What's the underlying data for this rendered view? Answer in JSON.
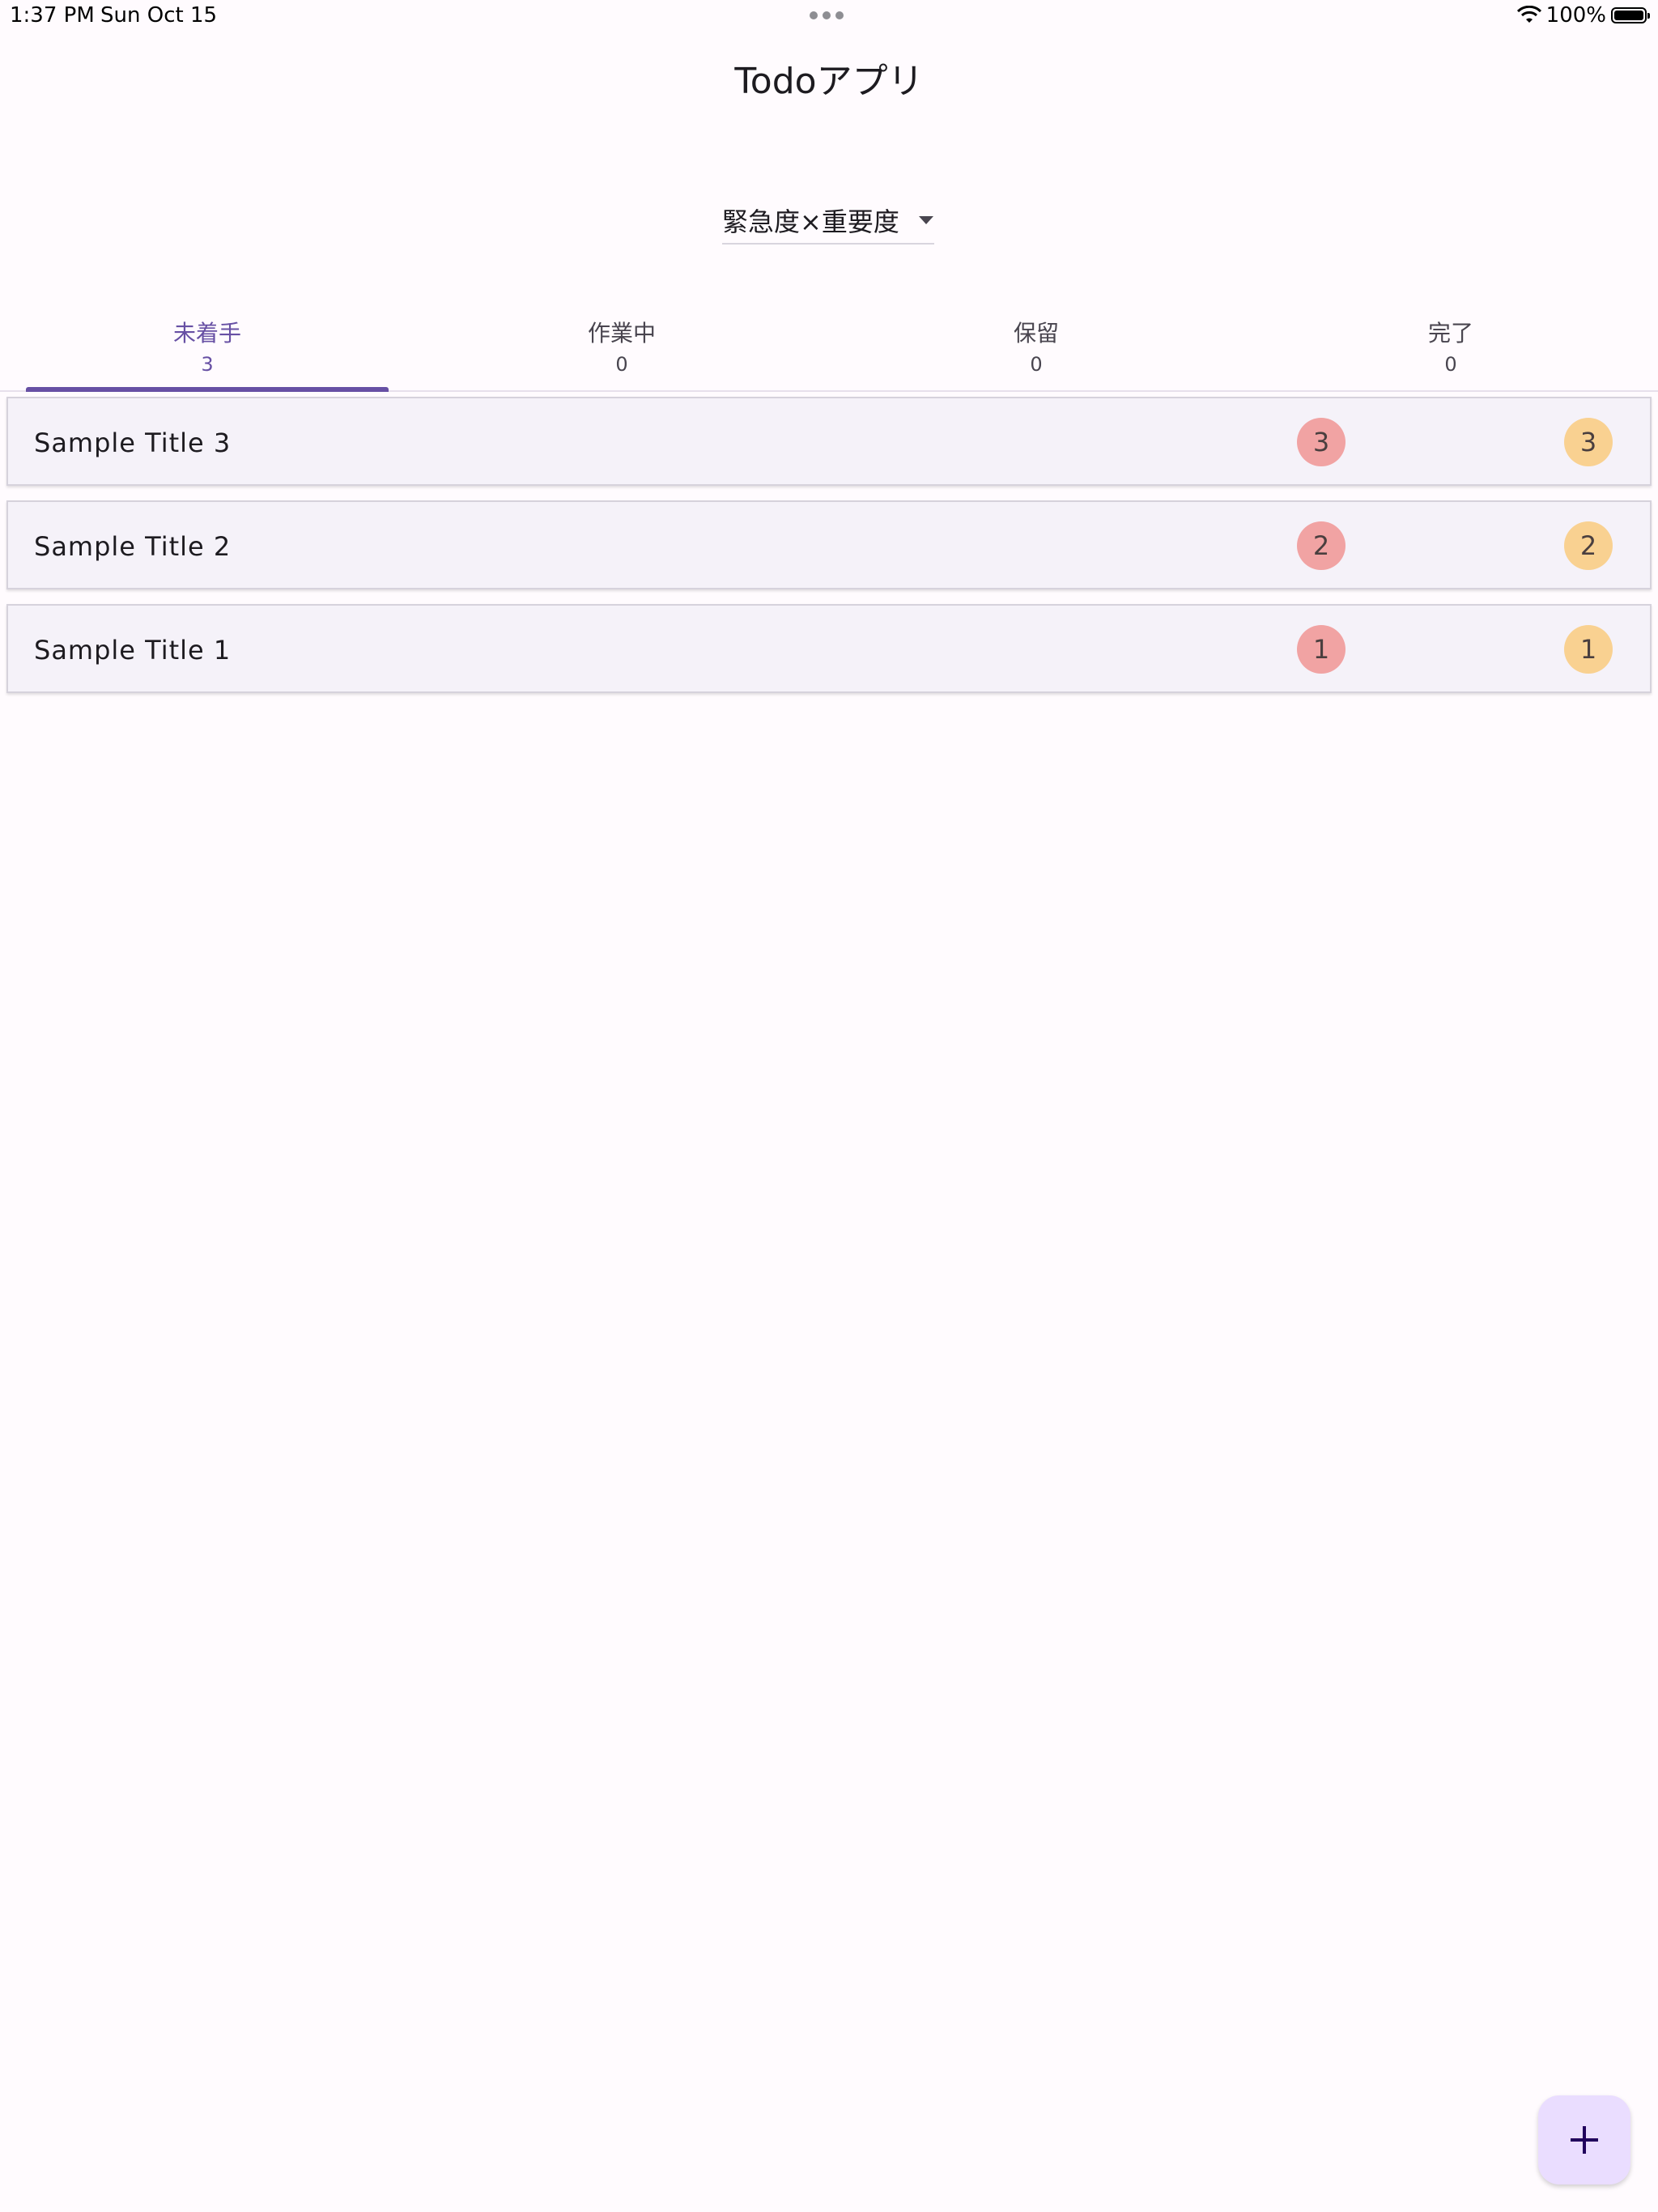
{
  "status_bar": {
    "time": "1:37 PM",
    "date": "Sun Oct 15",
    "battery": "100%"
  },
  "app": {
    "title": "Todoアプリ"
  },
  "sort": {
    "selected": "緊急度×重要度"
  },
  "tabs": [
    {
      "label": "未着手",
      "count": "3"
    },
    {
      "label": "作業中",
      "count": "0"
    },
    {
      "label": "保留",
      "count": "0"
    },
    {
      "label": "完了",
      "count": "0"
    }
  ],
  "todos": [
    {
      "title": "Sample Title 3",
      "urgency": "3",
      "importance": "3"
    },
    {
      "title": "Sample Title 2",
      "urgency": "2",
      "importance": "2"
    },
    {
      "title": "Sample Title 1",
      "urgency": "1",
      "importance": "1"
    }
  ],
  "colors": {
    "accent": "#6750a4",
    "urgency_badge": "#f1a3a3",
    "importance_badge": "#f9d191",
    "fab": "#eaddff"
  },
  "icons": {
    "fab": "plus-icon",
    "sort": "dropdown-arrow-icon"
  }
}
